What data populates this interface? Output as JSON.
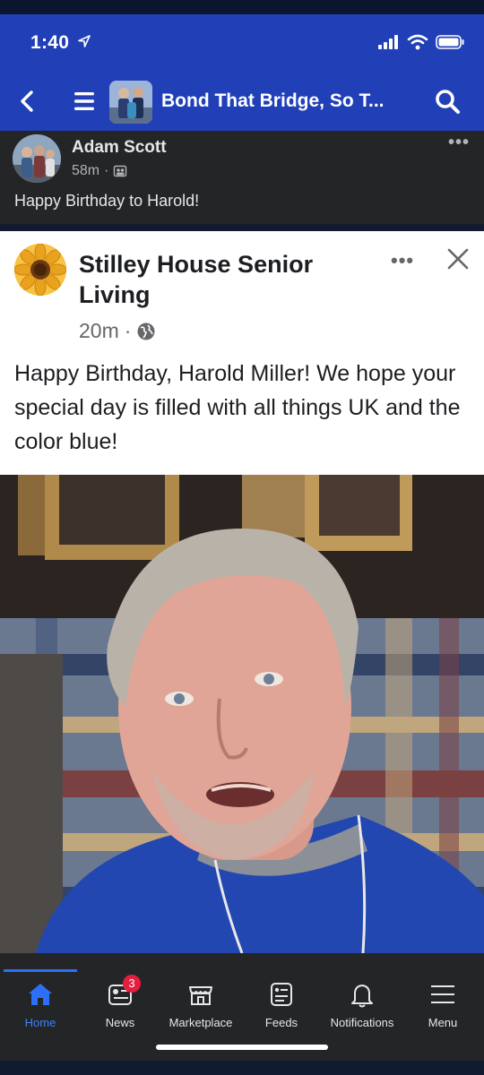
{
  "status": {
    "time": "1:40"
  },
  "nav": {
    "title": "Bond That Bridge, So T..."
  },
  "post1": {
    "author": "Adam Scott",
    "time": "58m",
    "dot": "·",
    "more": "•••",
    "text": "Happy Birthday to Harold!"
  },
  "post2": {
    "author": "Stilley House Senior Living",
    "time": "20m",
    "dot": "·",
    "more": "•••",
    "text": "Happy Birthday, Harold Miller! We hope your special day is filled with all things UK and the color blue!"
  },
  "tabs": [
    {
      "label": "Home",
      "icon": "home-icon",
      "active": true
    },
    {
      "label": "News",
      "icon": "news-icon",
      "badge": "3"
    },
    {
      "label": "Marketplace",
      "icon": "marketplace-icon"
    },
    {
      "label": "Feeds",
      "icon": "feeds-icon"
    },
    {
      "label": "Notifications",
      "icon": "bell-icon"
    },
    {
      "label": "Menu",
      "icon": "menu-icon"
    }
  ],
  "colors": {
    "header": "#2140b8",
    "dark_surface": "#242526",
    "accent": "#2d6ff6",
    "badge": "#e41e3f"
  }
}
